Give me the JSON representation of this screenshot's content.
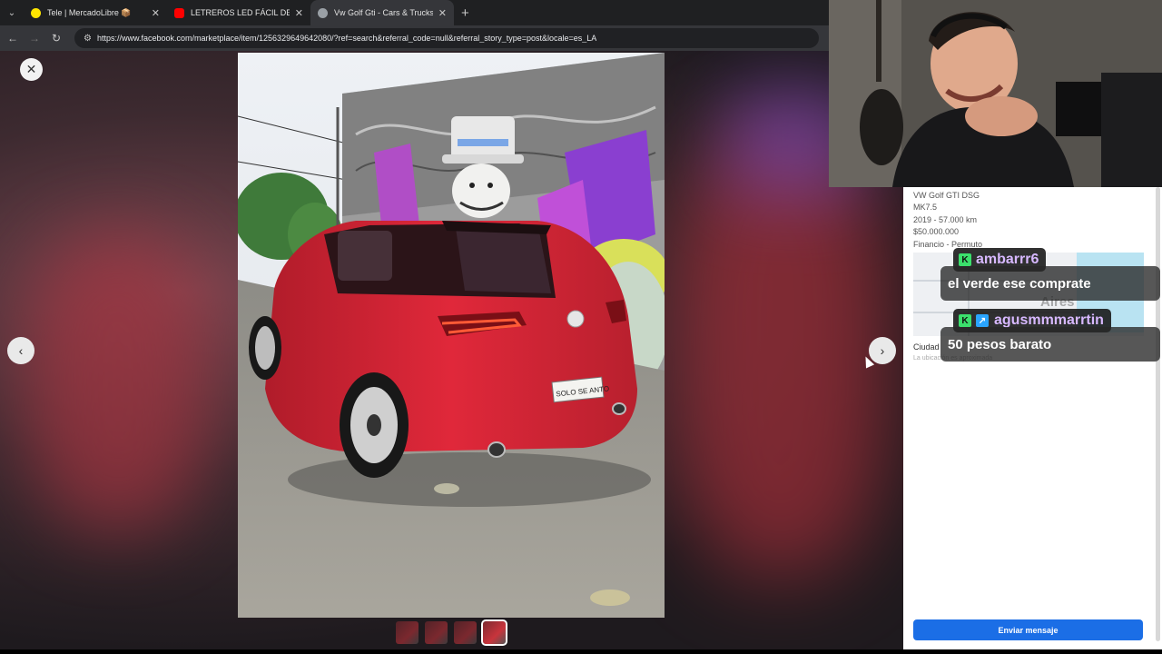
{
  "browser": {
    "tabs": [
      {
        "title": "Tele | MercadoLibre 📦",
        "favicon_color": "#ffe600",
        "active": false
      },
      {
        "title": "LETREROS LED FÁCIL DE PROGR",
        "favicon_color": "#ff0000",
        "active": false
      },
      {
        "title": "Vw Golf Gti - Cars & Trucks - B",
        "favicon_color": "#9aa0a6",
        "active": true
      }
    ],
    "new_tab_label": "+",
    "url": "https://www.facebook.com/marketplace/item/1256329649642080/?ref=search&referral_code=null&referral_story_type=post&locale=es_LA"
  },
  "viewer": {
    "close_label": "✕",
    "prev_label": "‹",
    "next_label": "›",
    "thumbnails": 4,
    "selected_thumbnail": 4,
    "plate_text": "SOLO SE ANTO"
  },
  "listing": {
    "title": "VW Golf GTI DSG",
    "subtitle": "MK7.5",
    "specs": "2019 - 57.000 km",
    "price": "$50.000.000",
    "payment": "Financio - Permuto",
    "map_label": "Aires",
    "location": "Ciudad",
    "location_note": "La ubicación es aproximada",
    "send_button": "Enviar mensaje"
  },
  "chat": [
    {
      "user": "ambarrr6",
      "message": "el verde ese comprate"
    },
    {
      "user": "agusmmmarrtin",
      "message": "50 pesos barato"
    }
  ],
  "colors": {
    "accent": "#1b6ee6",
    "chat_name": "#d7b8ff",
    "badge_green": "#3be06c"
  }
}
